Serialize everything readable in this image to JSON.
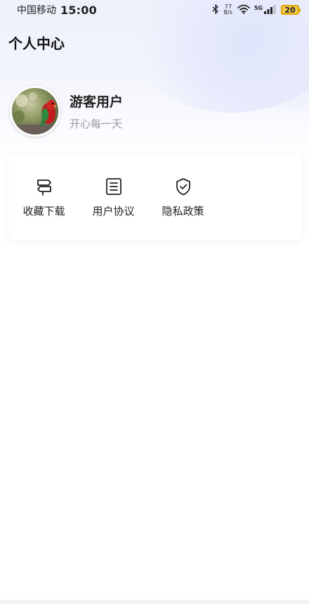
{
  "status_bar": {
    "carrier": "中国移动",
    "time": "15:00",
    "net_speed_value": "77",
    "net_speed_unit": "B/s",
    "network_type": "5G",
    "battery": "20",
    "battery_color": "#f2c94c"
  },
  "header": {
    "title": "个人中心"
  },
  "profile": {
    "username": "游客用户",
    "motto": "开心每一天"
  },
  "menu": {
    "items": [
      {
        "label": "收藏下载",
        "icon": "signpost-icon"
      },
      {
        "label": "用户协议",
        "icon": "document-icon"
      },
      {
        "label": "隐私政策",
        "icon": "shield-check-icon"
      }
    ]
  }
}
